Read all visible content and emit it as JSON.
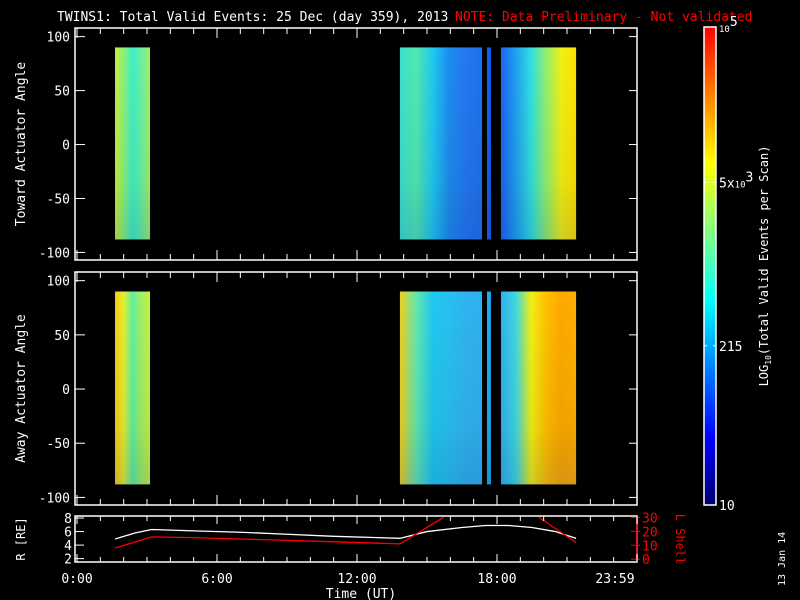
{
  "title": {
    "main": "TWINS1: Total Valid Events: 25 Dec (day 359), 2013",
    "note": "NOTE: Data Preliminary - Not validated",
    "note_color": "#ff0000"
  },
  "side_date": "13 Jan 14",
  "chart_data": [
    {
      "type": "heatmap",
      "name": "toward",
      "ylabel": "Toward Actuator Angle",
      "ylim": [
        -107,
        108
      ],
      "yticks": [
        "100",
        "50",
        "0",
        "-50",
        "-100"
      ],
      "ytick_values": [
        100,
        50,
        0,
        -50,
        -100
      ],
      "data_yrange": [
        -88,
        90
      ],
      "blocks": [
        {
          "t0": 1.63,
          "t1": 3.13,
          "colors": [
            "#c8f03c",
            "#8cf078",
            "#3cf0c8",
            "#6cf0a0",
            "#a0f064"
          ]
        },
        {
          "t0": 13.84,
          "t1": 17.36,
          "colors": [
            "#3ce0d0",
            "#50e8b0",
            "#20c8f0",
            "#1c8cf0",
            "#2478f0",
            "#2070f0"
          ]
        },
        {
          "t0": 17.57,
          "t1": 17.74,
          "colors": [
            "#1060f0",
            "#1060f0"
          ]
        },
        {
          "t0": 18.17,
          "t1": 21.39,
          "colors": [
            "#1c64f0",
            "#20a0f0",
            "#30e0e0",
            "#90f070",
            "#f0f014",
            "#ffe000"
          ]
        }
      ]
    },
    {
      "type": "heatmap",
      "name": "away",
      "ylabel": "Away Actuator Angle",
      "ylim": [
        -107,
        108
      ],
      "yticks": [
        "100",
        "50",
        "0",
        "-50",
        "-100"
      ],
      "ytick_values": [
        100,
        50,
        0,
        -50,
        -100
      ],
      "data_yrange": [
        -88,
        90
      ],
      "blocks": [
        {
          "t0": 1.63,
          "t1": 3.13,
          "colors": [
            "#ffc814",
            "#e0f030",
            "#60f0a0",
            "#a0f064",
            "#c8f040"
          ]
        },
        {
          "t0": 13.84,
          "t1": 17.36,
          "colors": [
            "#f0d020",
            "#60e8b0",
            "#20c8f0",
            "#28c0f0",
            "#30b4f0",
            "#30b0f0"
          ]
        },
        {
          "t0": 17.57,
          "t1": 17.74,
          "colors": [
            "#20a8f0",
            "#20a8f0"
          ]
        },
        {
          "t0": 18.17,
          "t1": 21.39,
          "colors": [
            "#30b0f0",
            "#40d8e0",
            "#f0f014",
            "#ffc000",
            "#ffa800",
            "#ffb000"
          ]
        }
      ]
    },
    {
      "type": "line",
      "name": "orbit",
      "ylabel": "R [RE]",
      "ylim": [
        1.5,
        8.3
      ],
      "yticks": [
        "8",
        "6",
        "4",
        "2"
      ],
      "ytick_values": [
        8,
        6,
        4,
        2
      ],
      "y2label": "L Shell",
      "y2lim": [
        -2,
        31
      ],
      "y2ticks": [
        "30",
        "20",
        "10",
        "0"
      ],
      "y2tick_values": [
        30,
        20,
        10,
        0
      ],
      "xlabel": "Time (UT)",
      "xticks": [
        "0:00",
        "6:00",
        "12:00",
        "18:00",
        "23:59"
      ],
      "xtick_values": [
        0,
        6,
        12,
        18,
        23.98
      ],
      "series": [
        {
          "name": "R",
          "color": "#ffffff",
          "axis": "left",
          "x": [
            1.63,
            2.5,
            3.2,
            5,
            7,
            9,
            11,
            13.84,
            15,
            16.5,
            17.5,
            18.5,
            19.5,
            20.5,
            21.39
          ],
          "y": [
            4.9,
            5.8,
            6.3,
            6.1,
            5.9,
            5.6,
            5.3,
            5.0,
            6.0,
            6.6,
            6.9,
            6.9,
            6.6,
            6.0,
            5.0
          ]
        },
        {
          "name": "L Shell",
          "color": "#ff0000",
          "axis": "right",
          "x": [
            1.63,
            3.2,
            5,
            7,
            9,
            11,
            13.84,
            15.7
          ],
          "y": [
            8,
            16,
            15.5,
            14.5,
            13.5,
            12.5,
            11,
            30
          ]
        },
        {
          "name": "L Shell (2)",
          "color": "#ff0000",
          "axis": "right",
          "x": [
            19.8,
            21.39
          ],
          "y": [
            30,
            12
          ]
        }
      ],
      "xlim": [
        0,
        24
      ]
    }
  ],
  "colorbar": {
    "label_prefix": "LOG",
    "label_sub": "10",
    "label_suffix": "(Total Valid Events per Scan)",
    "ticks": [
      {
        "base": "10",
        "exp": "5",
        "prefix": "",
        "value": 100000
      },
      {
        "base": "10",
        "exp": "3",
        "prefix": "5x",
        "value": 5000
      },
      {
        "base": "215",
        "exp": "",
        "prefix": "",
        "value": 215
      },
      {
        "base": "10",
        "exp": "",
        "prefix": "",
        "value": 10
      }
    ],
    "range": [
      10,
      100000
    ],
    "colors": [
      "#00006e",
      "#0000ff",
      "#0080ff",
      "#00ffff",
      "#80ff80",
      "#ffff00",
      "#ff8000",
      "#ff0000"
    ]
  }
}
